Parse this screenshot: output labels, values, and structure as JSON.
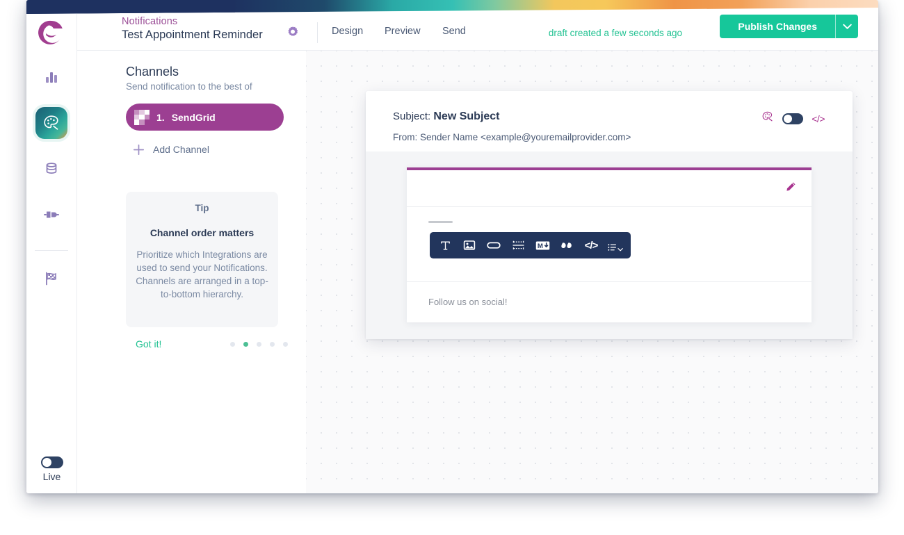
{
  "window": {
    "banner_colors": [
      "#1e3160",
      "#2aa9a6",
      "#f3c75c",
      "#ef9447",
      "#fcdcc0"
    ]
  },
  "sidebar": {
    "items": [
      {
        "name": "logo",
        "icon": "logo-icon",
        "label": ""
      },
      {
        "name": "analytics",
        "icon": "bar-chart-icon",
        "label": ""
      },
      {
        "name": "design",
        "icon": "palette-icon",
        "label": "",
        "active": true
      },
      {
        "name": "data",
        "icon": "database-icon",
        "label": ""
      },
      {
        "name": "integrations",
        "icon": "plug-icon",
        "label": ""
      },
      {
        "name": "journeys",
        "icon": "flag-icon",
        "label": ""
      }
    ],
    "live_toggle": {
      "label": "Live",
      "state": "off"
    }
  },
  "header": {
    "section": "Notifications",
    "title": "Test Appointment Reminder",
    "gear_icon": "gear-icon",
    "nav": [
      {
        "label": "Design"
      },
      {
        "label": "Preview"
      },
      {
        "label": "Send"
      }
    ],
    "draft_status": "draft created a few seconds ago",
    "publish_label": "Publish Changes",
    "publish_caret_icon": "chevron-down-icon",
    "accent_green": "#16c79a",
    "accent_purple": "#9b4f97"
  },
  "channels": {
    "title": "Channels",
    "subtitle": "Send notification to the best of",
    "items": [
      {
        "index": "1.",
        "name": "SendGrid",
        "icon": "sendgrid-icon"
      }
    ],
    "add_channel": {
      "label": "Add Channel",
      "icon": "plus-icon"
    }
  },
  "tip": {
    "kicker": "Tip",
    "heading": "Channel order matters",
    "body": "Prioritize which Integrations are used to send your Notifications. Channels are arranged in a top-to-bottom hierarchy.",
    "dismiss_label": "Got it!",
    "dots_total": 5,
    "dots_active_index": 1
  },
  "email": {
    "subject_label": "Subject:",
    "subject_value": "New Subject",
    "from_line": "From: Sender Name <example@youremailprovider.com>",
    "actions": {
      "palette_icon": "palette-brush-icon",
      "toggle_state": "off",
      "code_icon": "code-tag-icon",
      "code_icon_text": "</>"
    },
    "editor": {
      "accent_bar_color": "#9c3f92",
      "edit_icon": "pencil-icon",
      "toolbar": [
        {
          "name": "text-block-button",
          "icon": "text-icon",
          "glyph": "T"
        },
        {
          "name": "image-block-button",
          "icon": "image-icon"
        },
        {
          "name": "button-block-button",
          "icon": "button-icon"
        },
        {
          "name": "divider-block-button",
          "icon": "divider-icon"
        },
        {
          "name": "markdown-block-button",
          "icon": "markdown-icon",
          "glyph": "M"
        },
        {
          "name": "quote-block-button",
          "icon": "quote-icon",
          "glyph": "“"
        },
        {
          "name": "code-block-button",
          "icon": "code-icon",
          "glyph": "</>"
        },
        {
          "name": "list-block-button",
          "icon": "list-icon"
        }
      ],
      "footer_text": "Follow us on social!"
    }
  }
}
